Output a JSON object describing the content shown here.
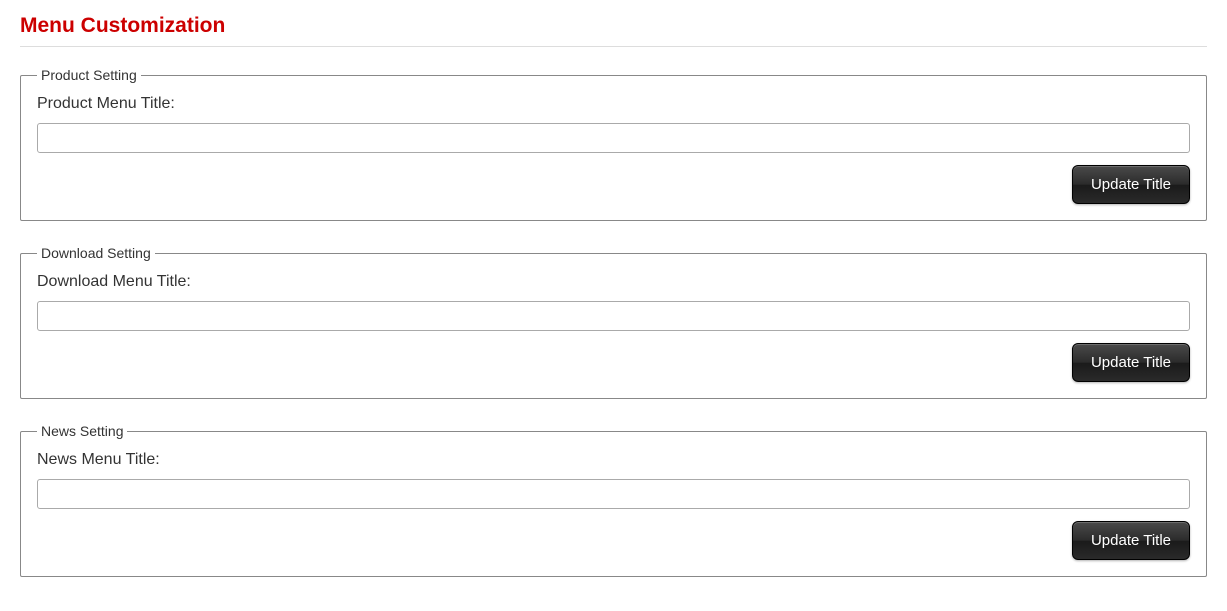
{
  "page": {
    "title": "Menu Customization"
  },
  "sections": {
    "product": {
      "legend": "Product Setting",
      "label": "Product Menu Title:",
      "value": "",
      "button_label": "Update Title"
    },
    "download": {
      "legend": "Download Setting",
      "label": "Download Menu Title:",
      "value": "",
      "button_label": "Update Title"
    },
    "news": {
      "legend": "News Setting",
      "label": "News Menu Title:",
      "value": "",
      "button_label": "Update Title"
    }
  }
}
